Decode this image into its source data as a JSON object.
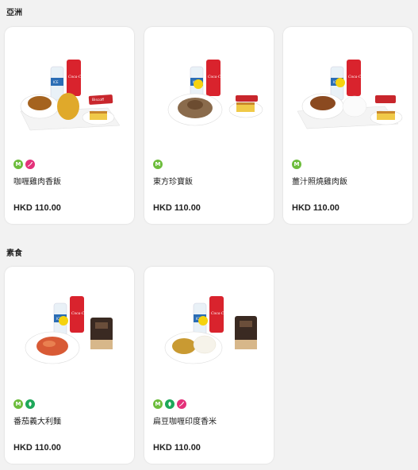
{
  "sections": [
    {
      "title": "亞洲"
    },
    {
      "title": "素食"
    }
  ],
  "colors": {
    "badge_m": "#6dbd3c",
    "badge_chili": "#e4317a",
    "badge_veg": "#1ea85a",
    "background": "#f2f2f2",
    "card": "#ffffff"
  },
  "items": [
    {
      "name": "咖喱雞肉香飯",
      "price": "HKD 110.00",
      "badges": [
        "M",
        "chili-icon"
      ],
      "image": "curry-chicken-rice-meal-set"
    },
    {
      "name": "東方珍寶飯",
      "price": "HKD 110.00",
      "badges": [
        "M"
      ],
      "image": "oriental-treasure-rice-meal-set"
    },
    {
      "name": "薑汁照燒雞肉飯",
      "price": "HKD 110.00",
      "badges": [
        "M"
      ],
      "image": "ginger-teriyaki-chicken-rice-meal-set"
    },
    {
      "name": "番茄義大利麵",
      "price": "HKD 110.00",
      "badges": [
        "M",
        "leaf-icon"
      ],
      "image": "tomato-pasta-meal-set"
    },
    {
      "name": "扁豆咖喱印度香米",
      "price": "HKD 110.00",
      "badges": [
        "M",
        "leaf-icon",
        "chili-icon"
      ],
      "image": "lentil-curry-basmati-meal-set"
    }
  ],
  "image_labels": {
    "water_brand": "ICE",
    "cola_brand": "Coca-Cola",
    "snack_brand": "Biscoff"
  }
}
